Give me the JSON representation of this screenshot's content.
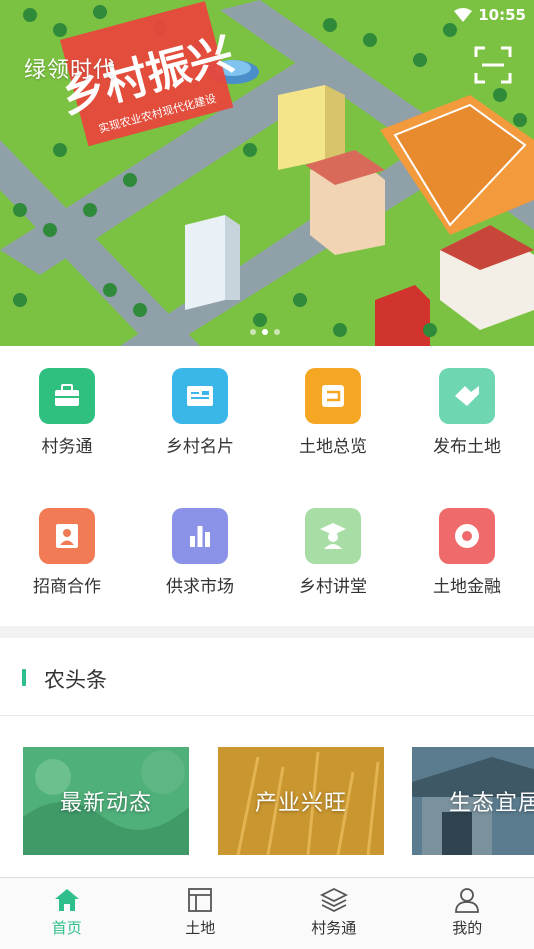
{
  "status_bar": {
    "time": "10:55"
  },
  "banner": {
    "brand_text": "绿领时代",
    "slogan_big": "乡村振兴",
    "slogan_small": "实现农业农村现代化建设",
    "slide_count": 3,
    "active_slide": 1
  },
  "functions": [
    {
      "label": "村务通",
      "icon": "briefcase-icon",
      "color": "#2fbf7f"
    },
    {
      "label": "乡村名片",
      "icon": "id-card-icon",
      "color": "#3bb6e8"
    },
    {
      "label": "土地总览",
      "icon": "overview-icon",
      "color": "#f5a623"
    },
    {
      "label": "发布土地",
      "icon": "handshake-icon",
      "color": "#6fd6b2"
    },
    {
      "label": "招商合作",
      "icon": "person-icon",
      "color": "#f07b54"
    },
    {
      "label": "供求市场",
      "icon": "bar-chart-icon",
      "color": "#8b93e8"
    },
    {
      "label": "乡村讲堂",
      "icon": "graduate-icon",
      "color": "#a8dda6"
    },
    {
      "label": "土地金融",
      "icon": "coin-icon",
      "color": "#ef6a6a"
    }
  ],
  "news": {
    "title": "农头条",
    "accent_color": "#2fbf8a",
    "cards": [
      {
        "label": "最新动态"
      },
      {
        "label": "产业兴旺"
      },
      {
        "label": "生态宜居"
      }
    ]
  },
  "tabbar": {
    "active_color": "#2fbf8a",
    "tabs": [
      {
        "label": "首页",
        "icon": "home-icon",
        "active": true
      },
      {
        "label": "土地",
        "icon": "land-icon",
        "active": false
      },
      {
        "label": "村务通",
        "icon": "layers-icon",
        "active": false
      },
      {
        "label": "我的",
        "icon": "user-icon",
        "active": false
      }
    ]
  }
}
